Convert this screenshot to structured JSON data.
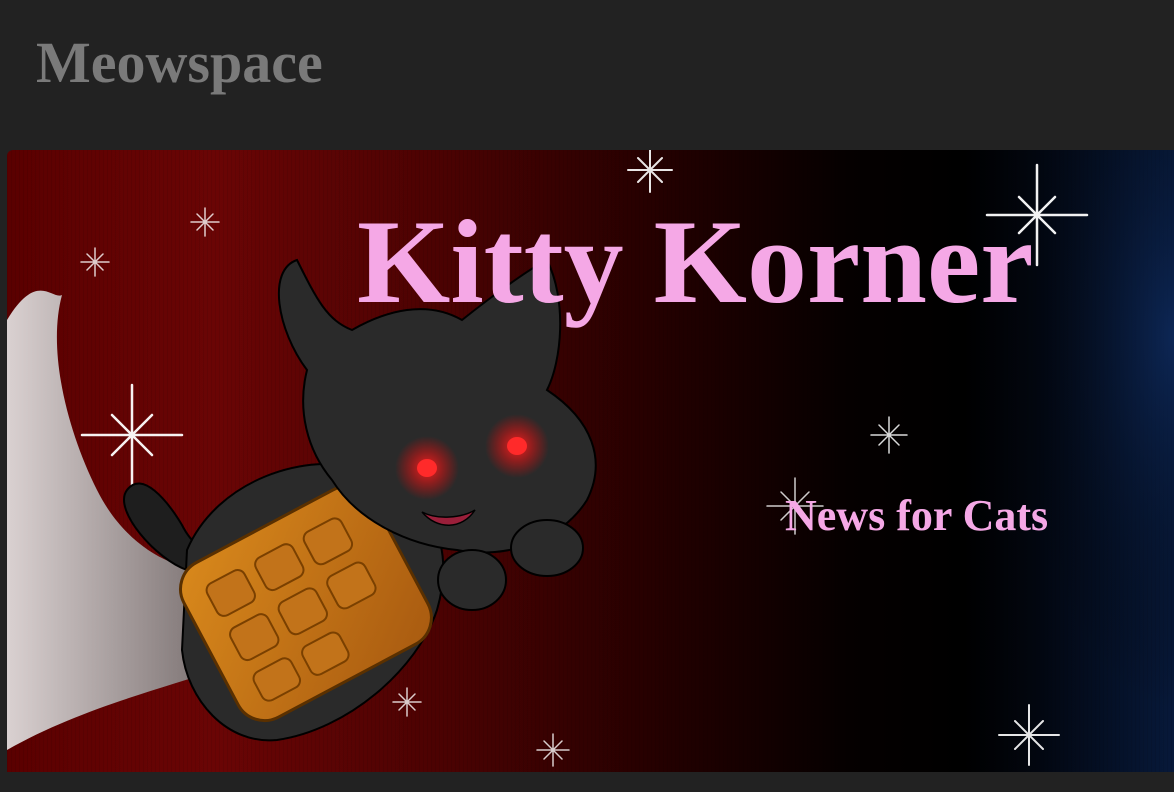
{
  "site": {
    "brand": "Meowspace"
  },
  "hero": {
    "title": "Kitty Korner",
    "subtitle": "News for Cats"
  }
}
